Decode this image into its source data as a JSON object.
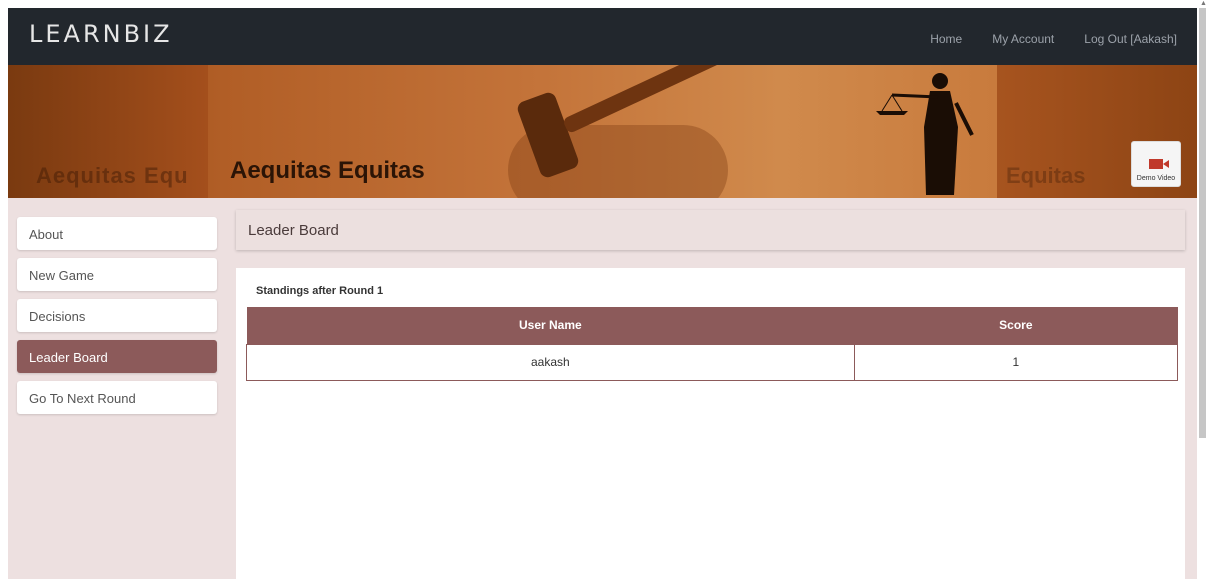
{
  "navbar": {
    "logo": "LEARNBIZ",
    "links": [
      "Home",
      "My Account",
      "Log Out [Aakash]"
    ]
  },
  "banner": {
    "title": "Aequitas Equitas",
    "ghost_left": "Aequitas Equ",
    "ghost_right": "Equitas",
    "demo_label": "Demo Video"
  },
  "sidebar": {
    "items": [
      {
        "label": "About",
        "active": false
      },
      {
        "label": "New Game",
        "active": false
      },
      {
        "label": "Decisions",
        "active": false
      },
      {
        "label": "Leader Board",
        "active": true
      },
      {
        "label": "Go To Next Round",
        "active": false
      }
    ]
  },
  "main": {
    "header": "Leader Board",
    "standings": "Standings after Round 1",
    "table": {
      "columns": [
        "User Name",
        "Score"
      ],
      "rows": [
        [
          "aakash",
          "1"
        ]
      ]
    }
  },
  "colors": {
    "navbar": "#22272d",
    "accent": "#8c5a5a",
    "content_bg": "#ede0e0"
  }
}
